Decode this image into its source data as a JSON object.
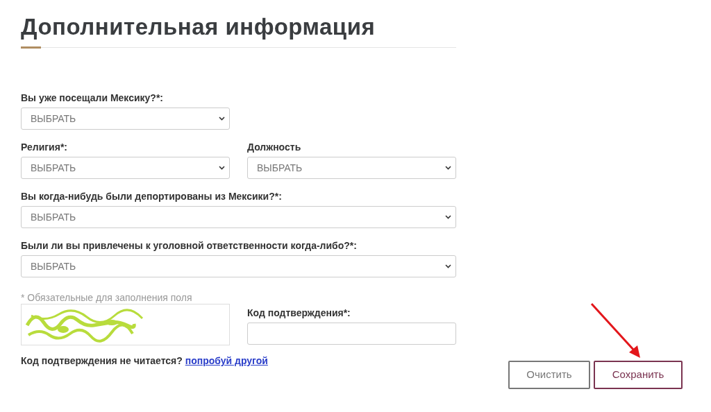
{
  "title": "Дополнительная информация",
  "rows": [
    [
      {
        "label": "Вы уже посещали Мексику?*:",
        "value": "ВЫБРАТЬ",
        "wide": false
      }
    ],
    [
      {
        "label": "Религия*:",
        "value": "ВЫБРАТЬ",
        "wide": false
      },
      {
        "label": "Должность",
        "value": "ВЫБРАТЬ",
        "wide": false
      }
    ],
    [
      {
        "label": "Вы когда-нибудь были депортированы из Мексики?*:",
        "value": "ВЫБРАТЬ",
        "wide": true
      }
    ],
    [
      {
        "label": "Были ли вы привлечены к уголовной ответственности когда-либо?*:",
        "value": "ВЫБРАТЬ",
        "wide": true
      }
    ]
  ],
  "required_note": "* Обязательные для заполнения поля",
  "captcha": {
    "label": "Код подтверждения*:"
  },
  "help": {
    "text": "Код подтверждения не читается?",
    "link": "попробуй другой"
  },
  "buttons": [
    {
      "label": "Очистить",
      "kind": "secondary"
    },
    {
      "label": "Сохранить",
      "kind": "primary"
    }
  ]
}
